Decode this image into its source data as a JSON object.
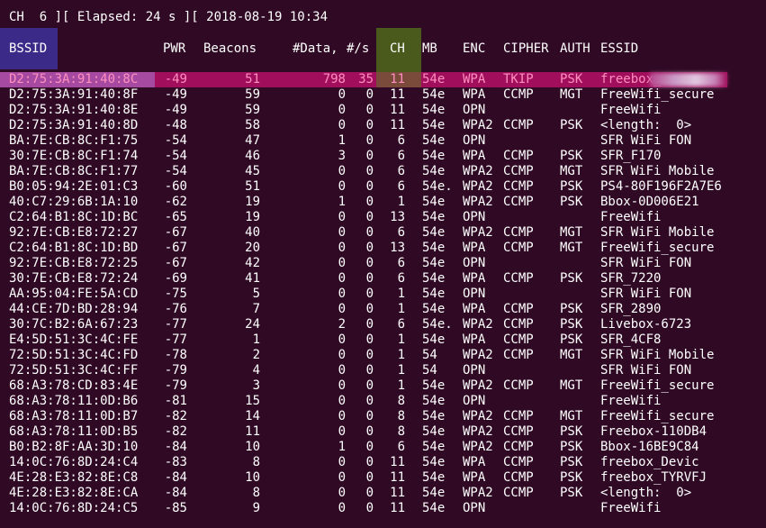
{
  "status": {
    "text": "CH  6 ][ Elapsed: 24 s ][ 2018-08-19 10:34"
  },
  "headers": {
    "bssid": "BSSID",
    "pwr": "PWR",
    "beacons": "Beacons",
    "data": "#Data,",
    "rate": "#/s",
    "ch": "CH",
    "mb": "MB",
    "enc": "ENC",
    "cipher": "CIPHER",
    "auth": "AUTH",
    "essid": "ESSID"
  },
  "rows": [
    {
      "bssid": "D2:75:3A:91:40:8C",
      "pwr": "-49",
      "beacons": "51",
      "data": "798",
      "rate": "35",
      "ch": "11",
      "mb": "54e",
      "enc": "WPA",
      "cipher": "TKIP",
      "auth": "PSK",
      "essid": "freebox_"
    },
    {
      "bssid": "D2:75:3A:91:40:8F",
      "pwr": "-49",
      "beacons": "59",
      "data": "0",
      "rate": "0",
      "ch": "11",
      "mb": "54e",
      "enc": "WPA",
      "cipher": "CCMP",
      "auth": "MGT",
      "essid": "FreeWifi_secure"
    },
    {
      "bssid": "D2:75:3A:91:40:8E",
      "pwr": "-49",
      "beacons": "59",
      "data": "0",
      "rate": "0",
      "ch": "11",
      "mb": "54e",
      "enc": "OPN",
      "cipher": "",
      "auth": "",
      "essid": "FreeWifi"
    },
    {
      "bssid": "D2:75:3A:91:40:8D",
      "pwr": "-48",
      "beacons": "58",
      "data": "0",
      "rate": "0",
      "ch": "11",
      "mb": "54e",
      "enc": "WPA2",
      "cipher": "CCMP",
      "auth": "PSK",
      "essid": "<length:  0>"
    },
    {
      "bssid": "BA:7E:CB:8C:F1:75",
      "pwr": "-54",
      "beacons": "47",
      "data": "1",
      "rate": "0",
      "ch": "6",
      "mb": "54e",
      "enc": "OPN",
      "cipher": "",
      "auth": "",
      "essid": "SFR WiFi FON"
    },
    {
      "bssid": "30:7E:CB:8C:F1:74",
      "pwr": "-54",
      "beacons": "46",
      "data": "3",
      "rate": "0",
      "ch": "6",
      "mb": "54e",
      "enc": "WPA",
      "cipher": "CCMP",
      "auth": "PSK",
      "essid": "SFR_F170"
    },
    {
      "bssid": "BA:7E:CB:8C:F1:77",
      "pwr": "-54",
      "beacons": "45",
      "data": "0",
      "rate": "0",
      "ch": "6",
      "mb": "54e",
      "enc": "WPA2",
      "cipher": "CCMP",
      "auth": "MGT",
      "essid": "SFR WiFi Mobile"
    },
    {
      "bssid": "B0:05:94:2E:01:C3",
      "pwr": "-60",
      "beacons": "51",
      "data": "0",
      "rate": "0",
      "ch": "6",
      "mb": "54e.",
      "enc": "WPA2",
      "cipher": "CCMP",
      "auth": "PSK",
      "essid": "PS4-80F196F2A7E6"
    },
    {
      "bssid": "40:C7:29:6B:1A:10",
      "pwr": "-62",
      "beacons": "19",
      "data": "1",
      "rate": "0",
      "ch": "1",
      "mb": "54e",
      "enc": "WPA2",
      "cipher": "CCMP",
      "auth": "PSK",
      "essid": "Bbox-0D006E21"
    },
    {
      "bssid": "C2:64:B1:8C:1D:BC",
      "pwr": "-65",
      "beacons": "19",
      "data": "0",
      "rate": "0",
      "ch": "13",
      "mb": "54e",
      "enc": "OPN",
      "cipher": "",
      "auth": "",
      "essid": "FreeWifi"
    },
    {
      "bssid": "92:7E:CB:E8:72:27",
      "pwr": "-67",
      "beacons": "40",
      "data": "0",
      "rate": "0",
      "ch": "6",
      "mb": "54e",
      "enc": "WPA2",
      "cipher": "CCMP",
      "auth": "MGT",
      "essid": "SFR WiFi Mobile"
    },
    {
      "bssid": "C2:64:B1:8C:1D:BD",
      "pwr": "-67",
      "beacons": "20",
      "data": "0",
      "rate": "0",
      "ch": "13",
      "mb": "54e",
      "enc": "WPA",
      "cipher": "CCMP",
      "auth": "MGT",
      "essid": "FreeWifi_secure"
    },
    {
      "bssid": "92:7E:CB:E8:72:25",
      "pwr": "-67",
      "beacons": "42",
      "data": "0",
      "rate": "0",
      "ch": "6",
      "mb": "54e",
      "enc": "OPN",
      "cipher": "",
      "auth": "",
      "essid": "SFR WiFi FON"
    },
    {
      "bssid": "30:7E:CB:E8:72:24",
      "pwr": "-69",
      "beacons": "41",
      "data": "0",
      "rate": "0",
      "ch": "6",
      "mb": "54e",
      "enc": "WPA",
      "cipher": "CCMP",
      "auth": "PSK",
      "essid": "SFR_7220"
    },
    {
      "bssid": "AA:95:04:FE:5A:CD",
      "pwr": "-75",
      "beacons": "5",
      "data": "0",
      "rate": "0",
      "ch": "1",
      "mb": "54e",
      "enc": "OPN",
      "cipher": "",
      "auth": "",
      "essid": "SFR WiFi FON"
    },
    {
      "bssid": "44:CE:7D:BD:28:94",
      "pwr": "-76",
      "beacons": "7",
      "data": "0",
      "rate": "0",
      "ch": "1",
      "mb": "54e",
      "enc": "WPA",
      "cipher": "CCMP",
      "auth": "PSK",
      "essid": "SFR_2890"
    },
    {
      "bssid": "30:7C:B2:6A:67:23",
      "pwr": "-77",
      "beacons": "24",
      "data": "2",
      "rate": "0",
      "ch": "6",
      "mb": "54e.",
      "enc": "WPA2",
      "cipher": "CCMP",
      "auth": "PSK",
      "essid": "Livebox-6723"
    },
    {
      "bssid": "E4:5D:51:3C:4C:FE",
      "pwr": "-77",
      "beacons": "1",
      "data": "0",
      "rate": "0",
      "ch": "1",
      "mb": "54e",
      "enc": "WPA",
      "cipher": "CCMP",
      "auth": "PSK",
      "essid": "SFR_4CF8"
    },
    {
      "bssid": "72:5D:51:3C:4C:FD",
      "pwr": "-78",
      "beacons": "2",
      "data": "0",
      "rate": "0",
      "ch": "1",
      "mb": "54",
      "enc": "WPA2",
      "cipher": "CCMP",
      "auth": "MGT",
      "essid": "SFR WiFi Mobile"
    },
    {
      "bssid": "72:5D:51:3C:4C:FF",
      "pwr": "-79",
      "beacons": "4",
      "data": "0",
      "rate": "0",
      "ch": "1",
      "mb": "54",
      "enc": "OPN",
      "cipher": "",
      "auth": "",
      "essid": "SFR WiFi FON"
    },
    {
      "bssid": "68:A3:78:CD:83:4E",
      "pwr": "-79",
      "beacons": "3",
      "data": "0",
      "rate": "0",
      "ch": "1",
      "mb": "54e",
      "enc": "WPA2",
      "cipher": "CCMP",
      "auth": "MGT",
      "essid": "FreeWifi_secure"
    },
    {
      "bssid": "68:A3:78:11:0D:B6",
      "pwr": "-81",
      "beacons": "15",
      "data": "0",
      "rate": "0",
      "ch": "8",
      "mb": "54e",
      "enc": "OPN",
      "cipher": "",
      "auth": "",
      "essid": "FreeWifi"
    },
    {
      "bssid": "68:A3:78:11:0D:B7",
      "pwr": "-82",
      "beacons": "14",
      "data": "0",
      "rate": "0",
      "ch": "8",
      "mb": "54e",
      "enc": "WPA2",
      "cipher": "CCMP",
      "auth": "MGT",
      "essid": "FreeWifi_secure"
    },
    {
      "bssid": "68:A3:78:11:0D:B5",
      "pwr": "-82",
      "beacons": "11",
      "data": "0",
      "rate": "0",
      "ch": "8",
      "mb": "54e",
      "enc": "WPA2",
      "cipher": "CCMP",
      "auth": "PSK",
      "essid": "Freebox-110DB4"
    },
    {
      "bssid": "B0:B2:8F:AA:3D:10",
      "pwr": "-84",
      "beacons": "10",
      "data": "1",
      "rate": "0",
      "ch": "6",
      "mb": "54e",
      "enc": "WPA2",
      "cipher": "CCMP",
      "auth": "PSK",
      "essid": "Bbox-16BE9C84"
    },
    {
      "bssid": "14:0C:76:8D:24:C4",
      "pwr": "-83",
      "beacons": "8",
      "data": "0",
      "rate": "0",
      "ch": "11",
      "mb": "54e",
      "enc": "WPA",
      "cipher": "CCMP",
      "auth": "PSK",
      "essid": "freebox_Devic"
    },
    {
      "bssid": "4E:28:E3:82:8E:C8",
      "pwr": "-84",
      "beacons": "10",
      "data": "0",
      "rate": "0",
      "ch": "11",
      "mb": "54e",
      "enc": "WPA",
      "cipher": "CCMP",
      "auth": "PSK",
      "essid": "freebox_TYRVFJ"
    },
    {
      "bssid": "4E:28:E3:82:8E:CA",
      "pwr": "-84",
      "beacons": "8",
      "data": "0",
      "rate": "0",
      "ch": "11",
      "mb": "54e",
      "enc": "WPA2",
      "cipher": "CCMP",
      "auth": "PSK",
      "essid": "<length:  0>"
    },
    {
      "bssid": "14:0C:76:8D:24:C5",
      "pwr": "-85",
      "beacons": "9",
      "data": "0",
      "rate": "0",
      "ch": "11",
      "mb": "54e",
      "enc": "OPN",
      "cipher": "",
      "auth": "",
      "essid": "FreeWifi"
    }
  ],
  "colors": {
    "background": "#300a24",
    "text": "#ffffff",
    "selected_row": "#a00e5c",
    "selected_text": "#ff8fc0",
    "bssid_header_highlight": "#3b2a87",
    "ch_header_highlight": "#4a5a1c"
  }
}
